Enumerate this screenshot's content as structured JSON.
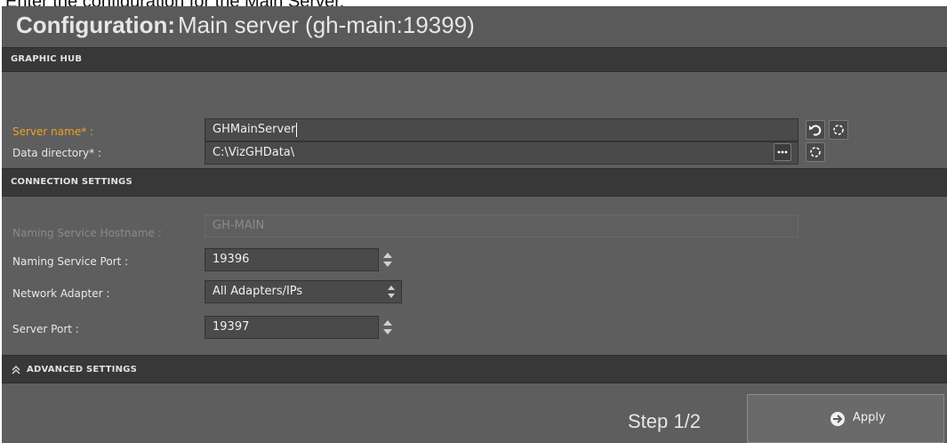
{
  "caption": "Enter the configuration for the Main Server.",
  "window": {
    "title_bold": "Configuration:",
    "title_rest": "Main server (gh-main:19399)"
  },
  "sections": {
    "graphic_hub": "GRAPHIC HUB",
    "connection": "CONNECTION SETTINGS",
    "advanced": "ADVANCED SETTINGS"
  },
  "graphic_hub": {
    "server_name_label": "Server name* :",
    "server_name_value": "GHMainServer",
    "data_dir_label": "Data directory* :",
    "data_dir_value": "C:\\VizGHData\\"
  },
  "connection": {
    "ns_hostname_label": "Naming Service Hostname :",
    "ns_hostname_value": "GH-MAIN",
    "ns_port_label": "Naming Service Port :",
    "ns_port_value": "19396",
    "adapter_label": "Network Adapter :",
    "adapter_value": "All Adapters/IPs",
    "server_port_label": "Server Port :",
    "server_port_value": "19397"
  },
  "footer": {
    "step": "Step 1/2",
    "apply": "Apply"
  },
  "colors": {
    "panel": "#5e5e5e",
    "section": "#383838",
    "field": "#4a4a4a",
    "required_label": "#f0a020"
  },
  "icons": [
    "undo-icon",
    "reset-icon",
    "browse-icon",
    "spinner-icon",
    "chevron-double-up-icon",
    "arrow-circle-right-icon"
  ]
}
